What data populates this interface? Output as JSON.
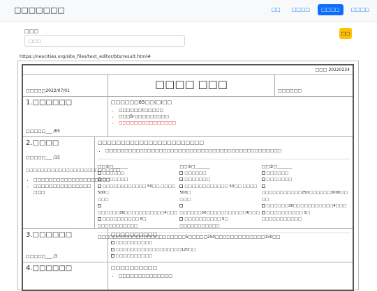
{
  "navbar": {
    "brand": "□□□□□□□",
    "links": [
      "□□",
      "□□□□",
      "□□□□",
      "□□□□"
    ],
    "active_index": 2
  },
  "search": {
    "label": "□□□",
    "placeholder": "□□□",
    "button_label": "□□"
  },
  "url": "https://neocities.org/site_files/text_editor/bts/result.html#",
  "doc": {
    "date_label": "□□□ 20220224",
    "left_date": "□□□□□2022/07/01",
    "title": "□□□□ □□□",
    "right_label": "□□□□□□",
    "sections": [
      {
        "title": "1.□□□□□□",
        "score": "□□□□□___ /65",
        "heading": "□□□□□□65□□(□)□□",
        "items": [
          {
            "text": "□□□□□□1□□□□□",
            "red": false
          },
          {
            "text": "□□□B-□□□□□□□□□",
            "red": false
          },
          {
            "text": "□□□□□□□□□□□□□□□",
            "red": true
          }
        ]
      },
      {
        "title": "2.□□□□",
        "score": "□□□□□___ /15",
        "left_note": "□□□□□□□□□□□□□□□□□□□□□□□□□□",
        "left_items": [
          "□□□□□□□□□□□□□□□□□□□□",
          "□□□□□□□□□□□□□□□"
        ],
        "left_items_cont": "□□□",
        "heading": "□□□□□□□□□□□□□□□□□□□□□□□",
        "bullet": "□□□□□□□□□□□□□□□□□□□□□□□□□□□□□□□□□□□□□□□□□□□□□□",
        "columns": [
          {
            "head": "□□①□_______",
            "items": [
              "□□□□□□",
              "□□□□□□□",
              "□□□□□□□□□□□□ 50□□ □□□□ 500□",
              "□□□",
              "□□□□□□30□□□□□□□□□□□4□□□",
              "□□□□□□□□□□ 5□ □□□□□□□□□□□"
            ]
          },
          {
            "head": "□□②□_______",
            "items": [
              "□□□□□□",
              "□□□□□□□",
              "□□□□□□□□□□□□ 50□□ □□□□ 500□",
              "□□□",
              "□□□□□□30□□□□□□□□□□□4□□□",
              "□□□□□□□□□□ 5□ □□□□□□□□□□□"
            ]
          },
          {
            "head": "□□③□_______",
            "items": [
              "□□□□□□",
              "□□□□□□□",
              "□□□□□□□□□□□250□□□□□□3000□□",
              "□□",
              "□□□□□□30□□□□□□□□□□□4□□□",
              "□□□□□□□□□□ 5□ □□□□□□□□□□□"
            ]
          }
        ],
        "note": "□□□□□□□□□□□□□□□□□□□□□□□5□□□□□250□□□□□□□□□□□□□150□□"
      },
      {
        "title": "3.□□□□□□",
        "score": "□□□□□___ /3",
        "heading": "□□□□□□□□□□",
        "checks": [
          "□□□□□□□□□□",
          "□□□□□□□□□□□□□□□□□□120□□",
          "□□□□□□□□□□"
        ]
      },
      {
        "title": "4.□□□□□□",
        "heading": "□□□□□□□□□□",
        "items": [
          "□□□□□□□□□□□□□□"
        ]
      }
    ]
  }
}
